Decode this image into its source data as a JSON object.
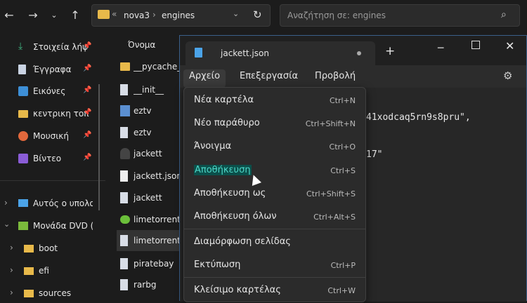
{
  "explorer": {
    "breadcrumb": [
      "nova3",
      "engines"
    ],
    "breadcrumb_overflow": "«",
    "search_placeholder": "Αναζήτηση σε: engines",
    "column_name": "Όνομα",
    "sidebar": {
      "quick": [
        {
          "label": "Στοιχεία λήψ",
          "icon": "download-icon",
          "pinned": true
        },
        {
          "label": "Έγγραφα",
          "icon": "document-icon",
          "pinned": true
        },
        {
          "label": "Εικόνες",
          "icon": "pictures-icon",
          "pinned": true
        },
        {
          "label": "κεντρικη τοπ",
          "icon": "folder-icon",
          "pinned": true
        },
        {
          "label": "Μουσική",
          "icon": "music-icon",
          "pinned": true
        },
        {
          "label": "Βίντεο",
          "icon": "video-icon",
          "pinned": true
        }
      ],
      "this_pc": "Αυτός ο υπολογ",
      "dvd": "Μονάδα DVD (D",
      "dvd_children": [
        "boot",
        "efi",
        "sources"
      ]
    },
    "files": [
      {
        "name": "__pycache__",
        "icon": "folder-icon"
      },
      {
        "name": "__init__",
        "icon": "python-file-icon"
      },
      {
        "name": "eztv",
        "icon": "eztv-icon"
      },
      {
        "name": "eztv",
        "icon": "python-file-icon"
      },
      {
        "name": "jackett",
        "icon": "jackett-icon"
      },
      {
        "name": "jackett.json",
        "icon": "file-icon"
      },
      {
        "name": "jackett",
        "icon": "python-file-icon"
      },
      {
        "name": "limetorrents",
        "icon": "limetorrents-icon"
      },
      {
        "name": "limetorrents",
        "icon": "python-file-icon"
      },
      {
        "name": "piratebay",
        "icon": "python-file-icon"
      },
      {
        "name": "rarbg",
        "icon": "python-file-icon"
      }
    ]
  },
  "notepad": {
    "tab_title": "jackett.json",
    "new_tab_glyph": "+",
    "menus": [
      "Αρχείο",
      "Επεξεργασία",
      "Προβολή"
    ],
    "editor_lines": [
      "41xodcaq5rn9s8pru\",",
      "17\""
    ],
    "file_menu": [
      {
        "label": "Νέα καρτέλα",
        "shortcut": "Ctrl+N"
      },
      {
        "label": "Νέο παράθυρο",
        "shortcut": "Ctrl+Shift+N"
      },
      {
        "label": "Άνοιγμα",
        "shortcut": "Ctrl+O"
      },
      {
        "label": "Αποθήκευση",
        "shortcut": "Ctrl+S"
      },
      {
        "label": "Αποθήκευση ως",
        "shortcut": "Ctrl+Shift+S"
      },
      {
        "label": "Αποθήκευση όλων",
        "shortcut": "Ctrl+Alt+S"
      },
      {
        "label": "Διαμόρφωση σελίδας",
        "shortcut": ""
      },
      {
        "label": "Εκτύπωση",
        "shortcut": "Ctrl+P"
      },
      {
        "label": "Κλείσιμο καρτέλας",
        "shortcut": "Ctrl+W"
      }
    ]
  },
  "colors": {
    "accent_highlight": "#0b4f4a",
    "highlight_text": "#4ed9c9",
    "folder": "#e8b94a"
  }
}
